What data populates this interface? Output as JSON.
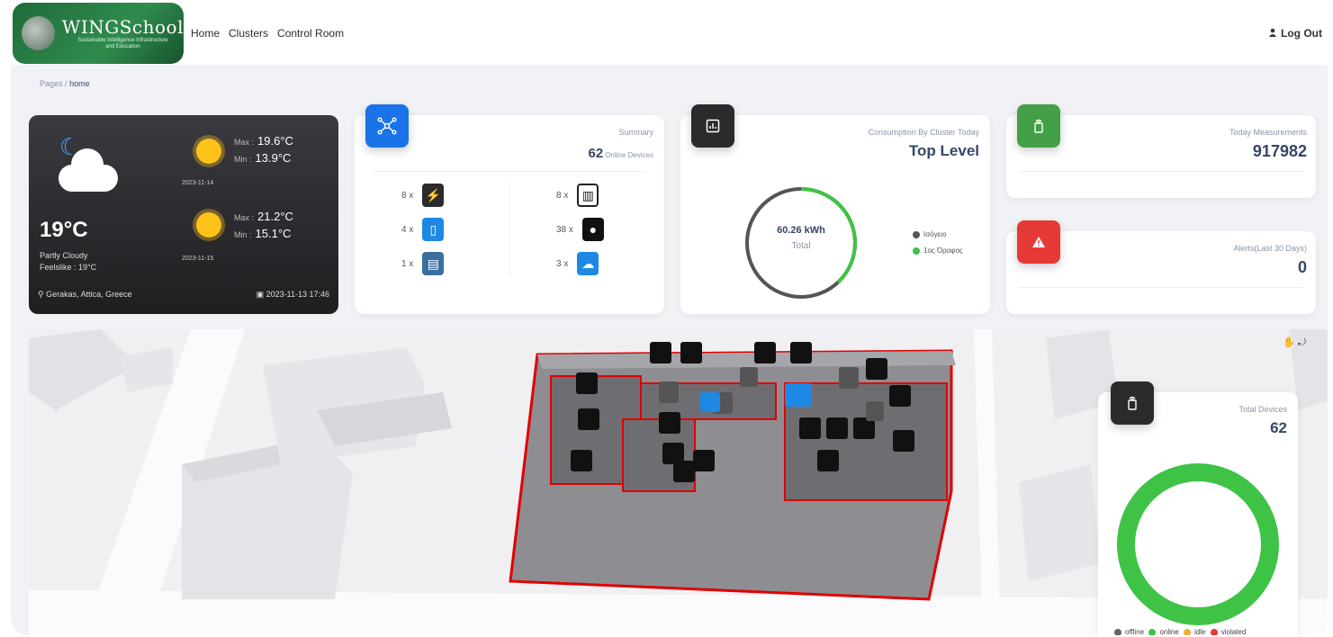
{
  "topbar": {
    "logo_title": "WINGSchool",
    "logo_sub_1": "Sustainable Intelligence Infrastructure",
    "logo_sub_2": "and Education",
    "nav": [
      {
        "label": "Home"
      },
      {
        "label": "Clusters"
      },
      {
        "label": "Control Room"
      }
    ],
    "logout": "Log Out"
  },
  "breadcrumb": {
    "root": "Pages",
    "sep": "/",
    "current": "home"
  },
  "weather": {
    "temp": "19°C",
    "condition": "Partly Cloudy",
    "feels": "Feelslike : 19°C",
    "location": "Gerakas, Attica, Greece",
    "datetime": "2023-11-13 17:46",
    "forecast": [
      {
        "max_label": "Max :",
        "max": "19.6°C",
        "min_label": "Min :",
        "min": "13.9°C",
        "date": "2023-11-14"
      },
      {
        "max_label": "Max :",
        "max": "21.2°C",
        "min_label": "Min :",
        "min": "15.1°C",
        "date": "2023-11-15"
      }
    ]
  },
  "summary": {
    "title": "Summary",
    "count": "62",
    "count_label": "Online Devices",
    "devices": [
      {
        "count": "8 x",
        "icon": "energy-meter-icon"
      },
      {
        "count": "8 x",
        "icon": "gateway-icon"
      },
      {
        "count": "4 x",
        "icon": "waste-bin-icon"
      },
      {
        "count": "38 x",
        "icon": "smart-plug-icon"
      },
      {
        "count": "1 x",
        "icon": "water-tank-icon"
      },
      {
        "count": "3 x",
        "icon": "weather-station-icon"
      }
    ]
  },
  "consumption": {
    "title": "Consumption By Cluster Today",
    "level": "Top Level",
    "value": "60.26 kWh",
    "value_label": "Total",
    "legend": [
      {
        "label": "Ισόγειο",
        "color": "#555555"
      },
      {
        "label": "1ος Όροφος",
        "color": "#3ec346"
      }
    ],
    "share": 0.38
  },
  "measurements": {
    "title": "Today Measurements",
    "value": "917982"
  },
  "alerts": {
    "title": "Alerts(Last 30 Days)",
    "value": "0"
  },
  "total_devices": {
    "title": "Total Devices",
    "value": "62",
    "legend": [
      {
        "label": "offline",
        "color": "#666666"
      },
      {
        "label": "online",
        "color": "#3ec346"
      },
      {
        "label": "idle",
        "color": "#f0b030"
      },
      {
        "label": "violated",
        "color": "#e53935"
      }
    ]
  },
  "colors": {
    "blue": "#1a73e8",
    "green": "#43a047",
    "red": "#e53935",
    "dark": "#2b2b2e"
  }
}
